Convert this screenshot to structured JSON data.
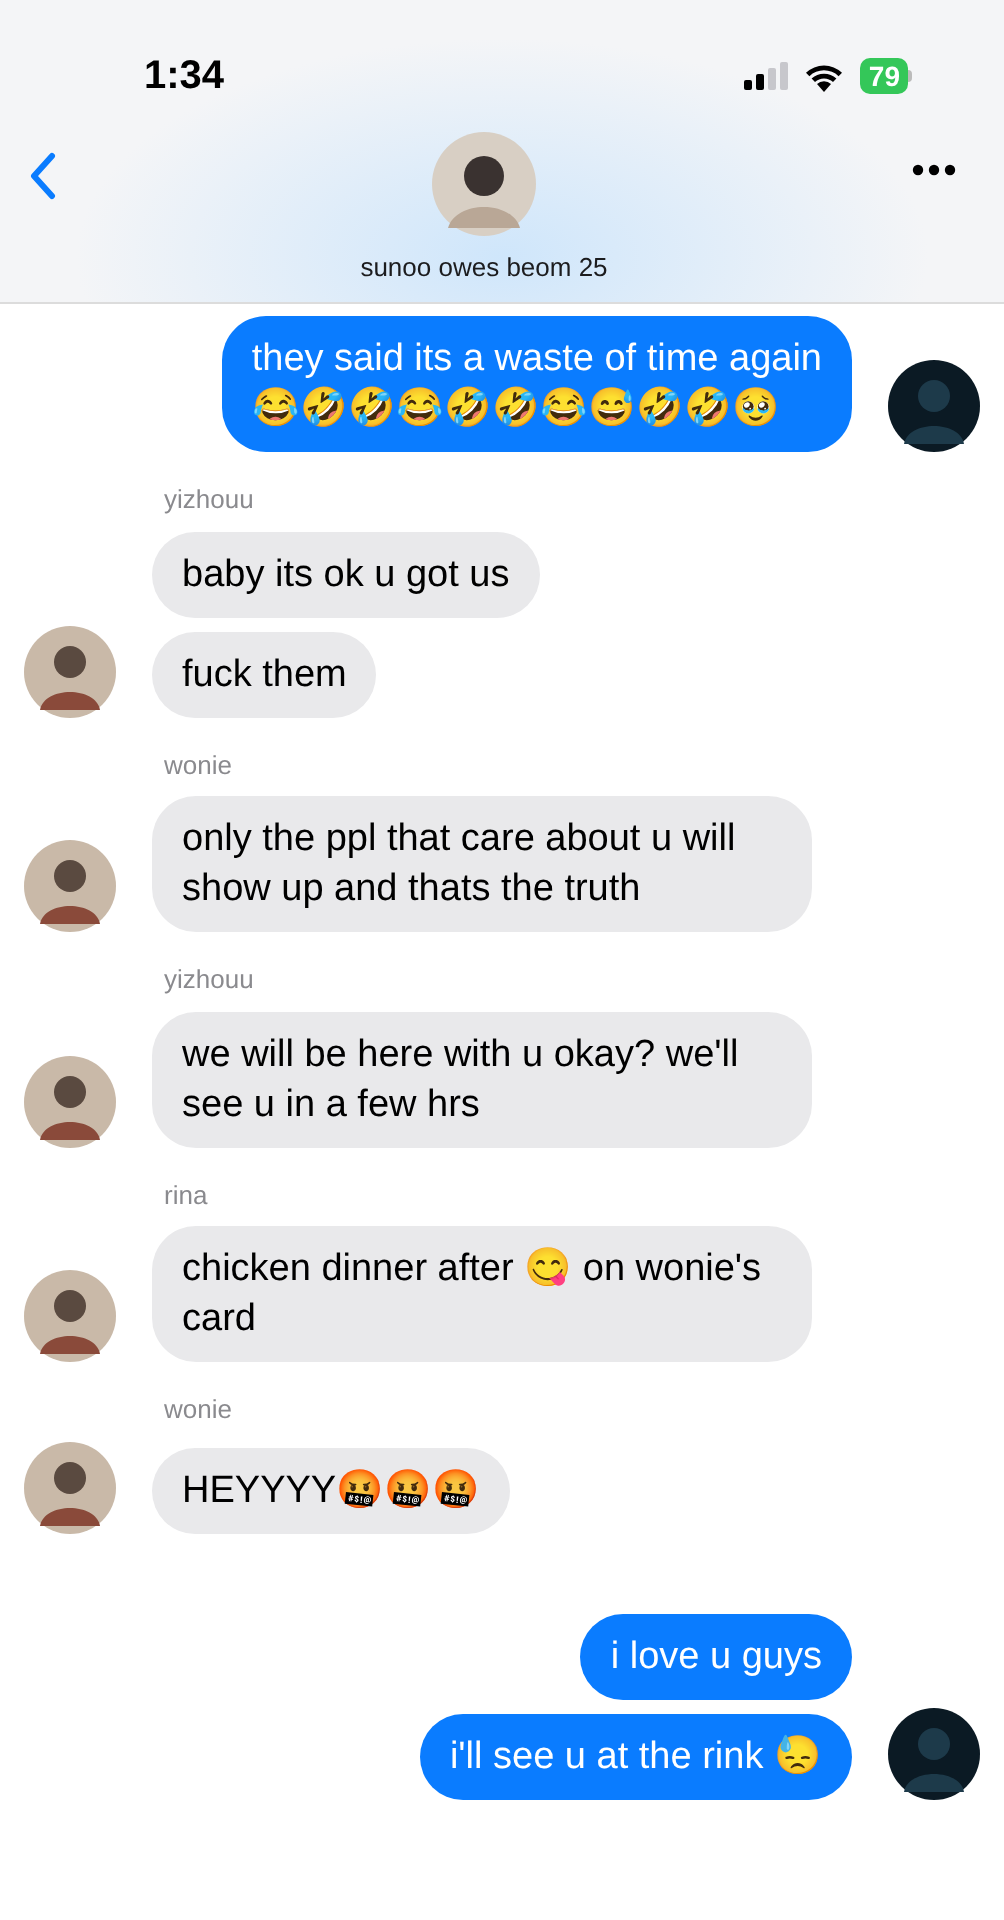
{
  "status_bar": {
    "time": "1:34",
    "battery": "79"
  },
  "header": {
    "title": "sunoo owes beom 25"
  },
  "groups": [
    {
      "kind": "outgoing",
      "messages": [
        "they said its a waste of time again\n😂🤣🤣😂🤣🤣😂😅🤣🤣🥹"
      ]
    },
    {
      "kind": "incoming",
      "sender": "yizhouu",
      "messages": [
        "baby its ok u got us",
        "fuck them"
      ]
    },
    {
      "kind": "incoming",
      "sender": "wonie",
      "messages": [
        "only the ppl that care about u will show up and thats the truth"
      ]
    },
    {
      "kind": "incoming",
      "sender": "yizhouu",
      "messages": [
        "we will be here with u okay? we'll see u in a few hrs"
      ]
    },
    {
      "kind": "incoming",
      "sender": "rina",
      "messages": [
        "chicken dinner after 😋 on wonie's card"
      ]
    },
    {
      "kind": "incoming",
      "sender": "wonie",
      "messages": [
        "HEYYYY🤬🤬🤬"
      ]
    },
    {
      "kind": "outgoing",
      "messages": [
        "i love u guys",
        "i'll see u at the rink 😓"
      ]
    }
  ]
}
